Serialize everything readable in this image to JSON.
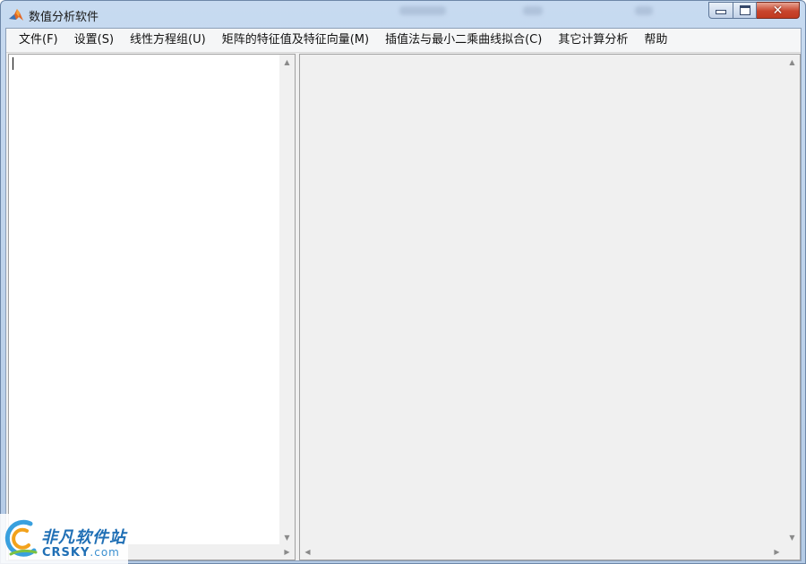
{
  "window": {
    "title": "数值分析软件",
    "icon": "matlab-icon",
    "controls": {
      "minimize": "minimize-icon",
      "maximize": "maximize-icon",
      "close": "close-icon"
    }
  },
  "menu": {
    "items": [
      {
        "label": "文件(F)"
      },
      {
        "label": "设置(S)"
      },
      {
        "label": "线性方程组(U)"
      },
      {
        "label": "矩阵的特征值及特征向量(M)"
      },
      {
        "label": "插值法与最小二乘曲线拟合(C)"
      },
      {
        "label": "其它计算分析"
      },
      {
        "label": "帮助"
      }
    ]
  },
  "panes": {
    "left": {
      "text": ""
    },
    "right": {
      "text": ""
    }
  },
  "watermark": {
    "cn": "非凡软件站",
    "en_main": "CRSKY",
    "en_sub": ".com"
  },
  "colors": {
    "close_button": "#c8452d",
    "watermark": "#1f6fb5"
  }
}
